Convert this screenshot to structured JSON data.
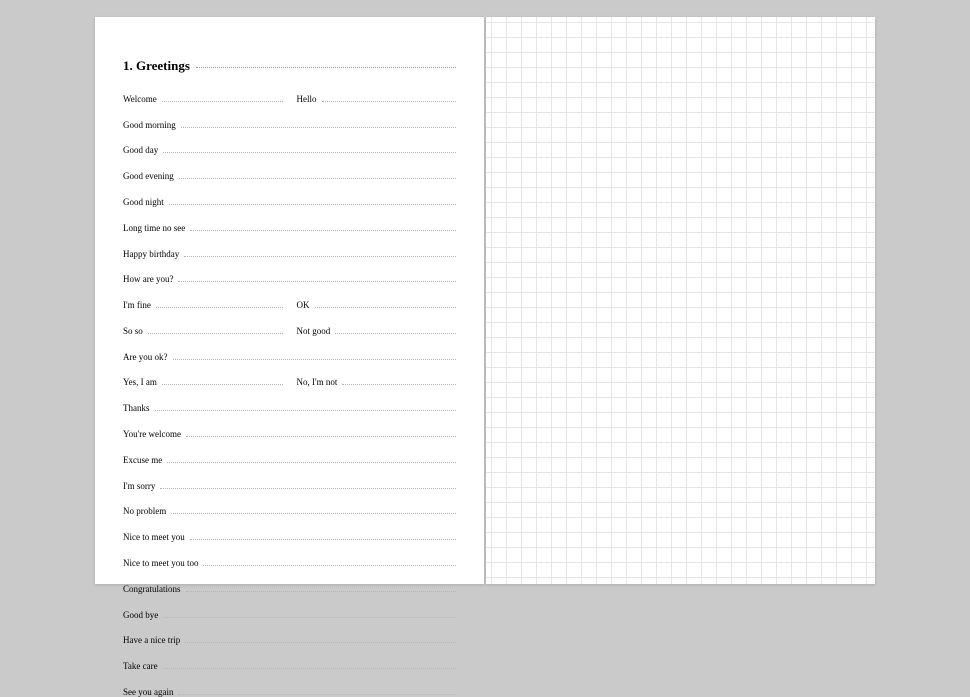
{
  "heading": "1. Greetings",
  "rows": [
    [
      {
        "term": "Welcome"
      },
      {
        "term": "Hello"
      }
    ],
    [
      {
        "term": "Good morning"
      }
    ],
    [
      {
        "term": "Good day"
      }
    ],
    [
      {
        "term": "Good evening"
      }
    ],
    [
      {
        "term": "Good night"
      }
    ],
    [
      {
        "term": "Long time no see"
      }
    ],
    [
      {
        "term": "Happy birthday"
      }
    ],
    [
      {
        "term": "How are you?"
      }
    ],
    [
      {
        "term": "I'm fine"
      },
      {
        "term": "OK"
      }
    ],
    [
      {
        "term": "So so"
      },
      {
        "term": "Not good"
      }
    ],
    [
      {
        "term": "Are you ok?"
      }
    ],
    [
      {
        "term": "Yes, I am"
      },
      {
        "term": "No, I'm not"
      }
    ],
    [
      {
        "term": "Thanks"
      }
    ],
    [
      {
        "term": "You're welcome"
      }
    ],
    [
      {
        "term": "Excuse me"
      }
    ],
    [
      {
        "term": "I'm sorry"
      }
    ],
    [
      {
        "term": "No problem"
      }
    ],
    [
      {
        "term": "Nice to meet you"
      }
    ],
    [
      {
        "term": "Nice to meet you too"
      }
    ],
    [
      {
        "term": "Congratulations"
      }
    ],
    [
      {
        "term": "Good bye"
      }
    ],
    [
      {
        "term": "Have a nice trip"
      }
    ],
    [
      {
        "term": "Take care"
      }
    ],
    [
      {
        "term": "See you again"
      }
    ]
  ]
}
